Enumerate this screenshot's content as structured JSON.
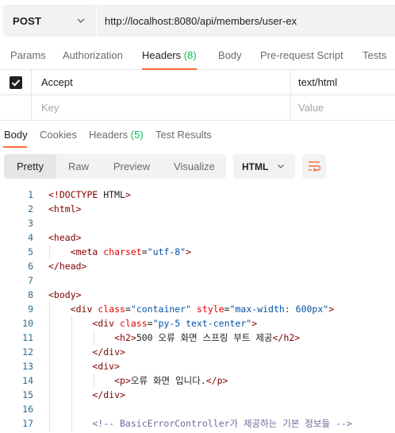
{
  "request": {
    "method": "POST",
    "url": "http://localhost:8080/api/members/user-ex"
  },
  "request_tabs": [
    {
      "label": "Params"
    },
    {
      "label": "Authorization"
    },
    {
      "label": "Headers",
      "count": "(8)",
      "active": true
    },
    {
      "label": "Body"
    },
    {
      "label": "Pre-request Script"
    },
    {
      "label": "Tests"
    }
  ],
  "headers_table": {
    "rows": [
      {
        "checked": true,
        "key": "Accept",
        "value": "text/html"
      }
    ],
    "key_placeholder": "Key",
    "value_placeholder": "Value"
  },
  "response_tabs": [
    {
      "label": "Body",
      "active": true
    },
    {
      "label": "Cookies"
    },
    {
      "label": "Headers",
      "count": "(5)"
    },
    {
      "label": "Test Results"
    }
  ],
  "view_modes": [
    "Pretty",
    "Raw",
    "Preview",
    "Visualize"
  ],
  "active_view_mode": "Pretty",
  "language": "HTML",
  "code_lines": [
    {
      "n": "1",
      "text": "<!DOCTYPE HTML>"
    },
    {
      "n": "2",
      "text": "<html>"
    },
    {
      "n": "3",
      "text": ""
    },
    {
      "n": "4",
      "text": "<head>"
    },
    {
      "n": "5",
      "text": "    <meta charset=\"utf-8\">"
    },
    {
      "n": "6",
      "text": "</head>"
    },
    {
      "n": "7",
      "text": ""
    },
    {
      "n": "8",
      "text": "<body>"
    },
    {
      "n": "9",
      "text": "    <div class=\"container\" style=\"max-width: 600px\">"
    },
    {
      "n": "10",
      "text": "        <div class=\"py-5 text-center\">"
    },
    {
      "n": "11",
      "text": "            <h2>500 오류 화면 스프링 부트 제공</h2>"
    },
    {
      "n": "12",
      "text": "        </div>"
    },
    {
      "n": "13",
      "text": "        <div>"
    },
    {
      "n": "14",
      "text": "            <p>오류 화면 입니다.</p>"
    },
    {
      "n": "15",
      "text": "        </div>"
    },
    {
      "n": "16",
      "text": ""
    },
    {
      "n": "17",
      "text": "        <!-- BasicErrorController가 제공하는 기본 정보들 -->"
    }
  ],
  "colors": {
    "accent": "#ff6c37",
    "count_green": "#0cbb52",
    "tag": "#800000",
    "attr": "#e50000",
    "string": "#0451a5",
    "comment": "#6a6a9b",
    "line_number": "#2c6b8f"
  },
  "icons": {
    "method_dropdown": "chevron-down-icon",
    "checkbox": "checkmark-icon",
    "language_dropdown": "chevron-down-icon",
    "wrap": "wrap-lines-icon"
  }
}
